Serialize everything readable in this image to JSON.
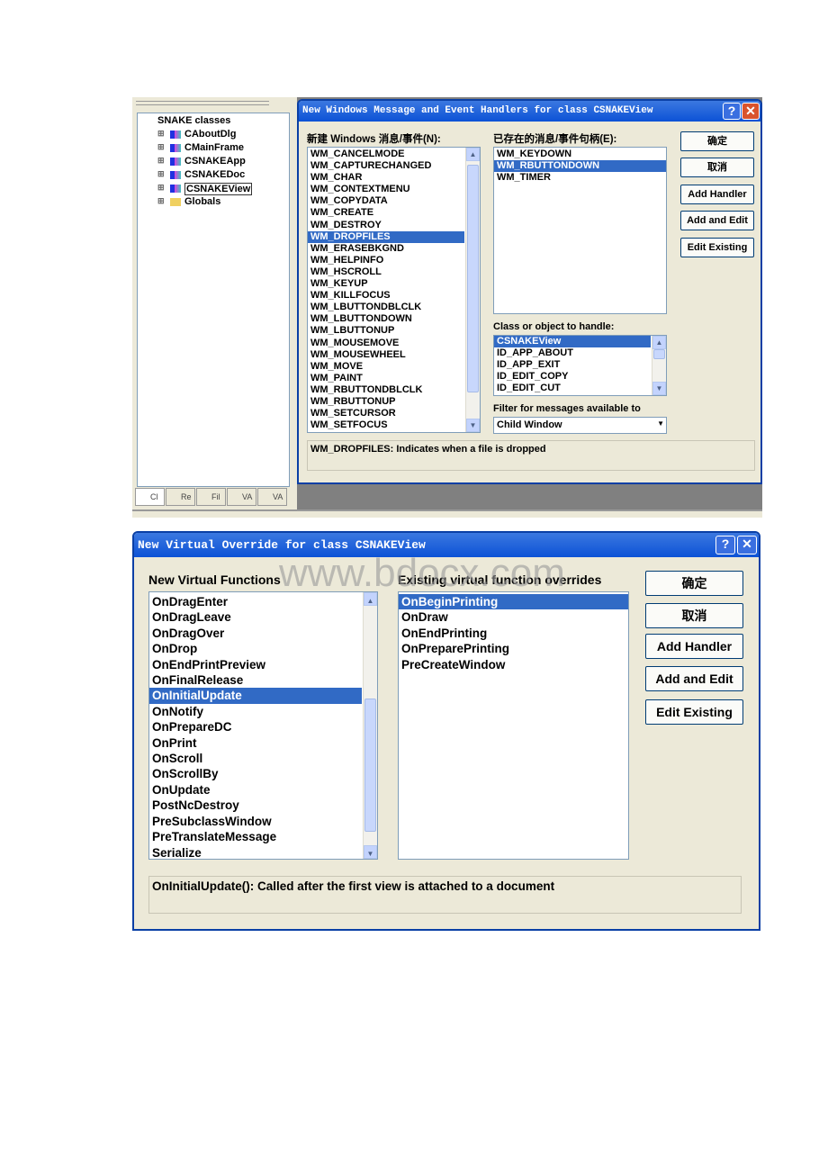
{
  "watermark": "www.bdocx.com",
  "top_window": {
    "class_tree": {
      "root": "SNAKE classes",
      "items": [
        "CAboutDlg",
        "CMainFrame",
        "CSNAKEApp",
        "CSNAKEDoc",
        "CSNAKEView",
        "Globals"
      ],
      "selected": "CSNAKEView"
    },
    "bottom_tabs": [
      "Cl",
      "Re",
      "Fil",
      "VA",
      "VA"
    ],
    "dialog": {
      "title": "New Windows Message and Event Handlers for class CSNAKEView",
      "new_messages_label": "新建 Windows 消息/事件(N):",
      "new_messages": [
        "WM_CANCELMODE",
        "WM_CAPTURECHANGED",
        "WM_CHAR",
        "WM_CONTEXTMENU",
        "WM_COPYDATA",
        "WM_CREATE",
        "WM_DESTROY",
        "WM_DROPFILES",
        "WM_ERASEBKGND",
        "WM_HELPINFO",
        "WM_HSCROLL",
        "WM_KEYUP",
        "WM_KILLFOCUS",
        "WM_LBUTTONDBLCLK",
        "WM_LBUTTONDOWN",
        "WM_LBUTTONUP",
        "WM_MOUSEMOVE",
        "WM_MOUSEWHEEL",
        "WM_MOVE",
        "WM_PAINT",
        "WM_RBUTTONDBLCLK",
        "WM_RBUTTONUP",
        "WM_SETCURSOR",
        "WM_SETFOCUS"
      ],
      "new_messages_selected": "WM_DROPFILES",
      "existing_label": "已存在的消息/事件句柄(E):",
      "existing": [
        "WM_KEYDOWN",
        "WM_RBUTTONDOWN",
        "WM_TIMER"
      ],
      "existing_selected": "WM_RBUTTONDOWN",
      "class_label": "Class or object to handle:",
      "classes": [
        "CSNAKEView",
        "ID_APP_ABOUT",
        "ID_APP_EXIT",
        "ID_EDIT_COPY",
        "ID_EDIT_CUT"
      ],
      "class_selected": "CSNAKEView",
      "filter_label": "Filter for messages available to",
      "filter_value": "Child Window",
      "buttons": [
        "确定",
        "取消",
        "Add Handler",
        "Add and Edit",
        "Edit Existing"
      ],
      "description": "WM_DROPFILES:  Indicates when a file is dropped"
    }
  },
  "bottom_dialog": {
    "title": "New Virtual Override for class CSNAKEView",
    "new_label": "New Virtual Functions",
    "new_functions": [
      "OnDragEnter",
      "OnDragLeave",
      "OnDragOver",
      "OnDrop",
      "OnEndPrintPreview",
      "OnFinalRelease",
      "OnInitialUpdate",
      "OnNotify",
      "OnPrepareDC",
      "OnPrint",
      "OnScroll",
      "OnScrollBy",
      "OnUpdate",
      "PostNcDestroy",
      "PreSubclassWindow",
      "PreTranslateMessage",
      "Serialize"
    ],
    "new_selected": "OnInitialUpdate",
    "existing_label": "Existing virtual function overrides",
    "existing": [
      "OnBeginPrinting",
      "OnDraw",
      "OnEndPrinting",
      "OnPreparePrinting",
      "PreCreateWindow"
    ],
    "existing_selected": "OnBeginPrinting",
    "buttons": [
      "确定",
      "取消",
      "Add Handler",
      "Add and Edit",
      "Edit Existing"
    ],
    "description": "OnInitialUpdate():  Called after the first view is attached to a document"
  },
  "colors": {
    "selection": "#316ac5",
    "titlebar": "#0c52d6",
    "dialog_bg": "#ece9d8"
  }
}
